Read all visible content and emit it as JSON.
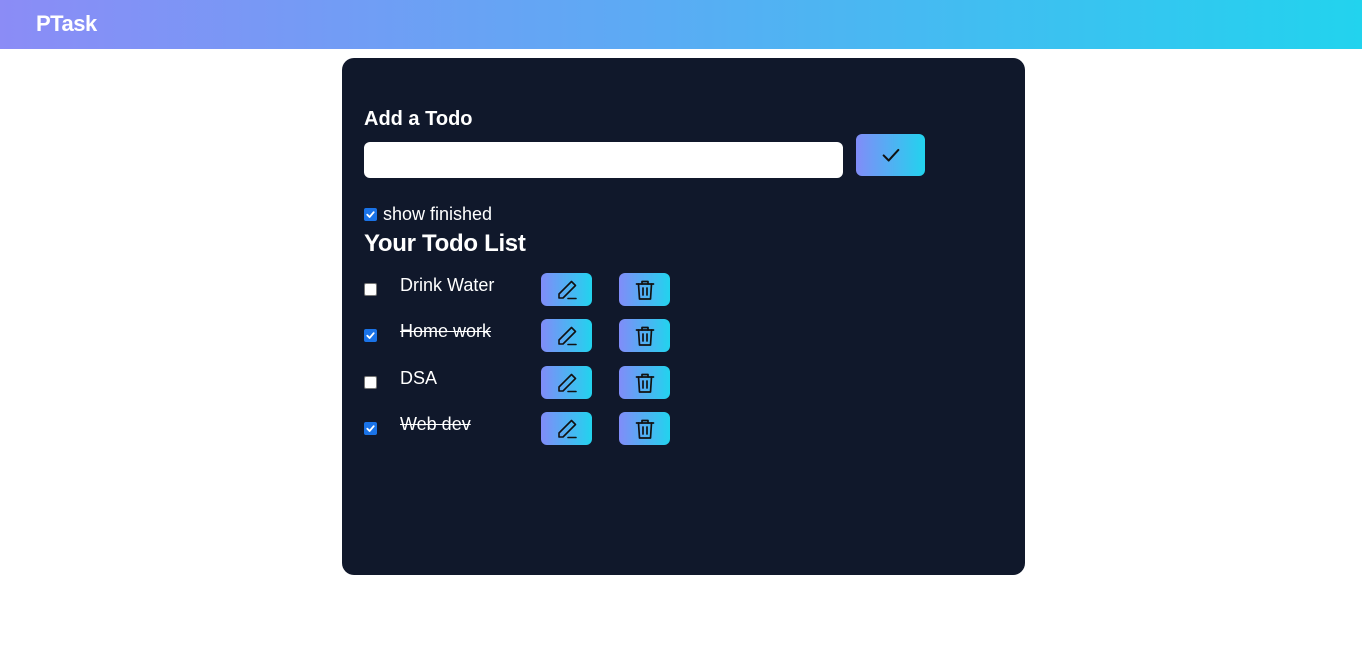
{
  "navbar": {
    "brand": "PTask",
    "gradient": [
      "#8b8cf6",
      "#22d3ee"
    ]
  },
  "add_todo": {
    "heading": "Add a Todo",
    "input_value": "",
    "input_placeholder": "",
    "save_icon": "check-icon"
  },
  "filter": {
    "show_finished_label": "show finished",
    "show_finished_checked": true
  },
  "list": {
    "heading": "Your Todo List",
    "items": [
      {
        "text": "Drink Water",
        "completed": false
      },
      {
        "text": "Home work",
        "completed": true
      },
      {
        "text": "DSA",
        "completed": false
      },
      {
        "text": "Web dev",
        "completed": true
      }
    ],
    "edit_icon": "pencil-icon",
    "delete_icon": "trash-icon"
  },
  "colors": {
    "panel_bg": "#10182b",
    "accent_start": "#818cf8",
    "accent_end": "#22d3ee",
    "checkbox_checked": "#1a73e8"
  }
}
